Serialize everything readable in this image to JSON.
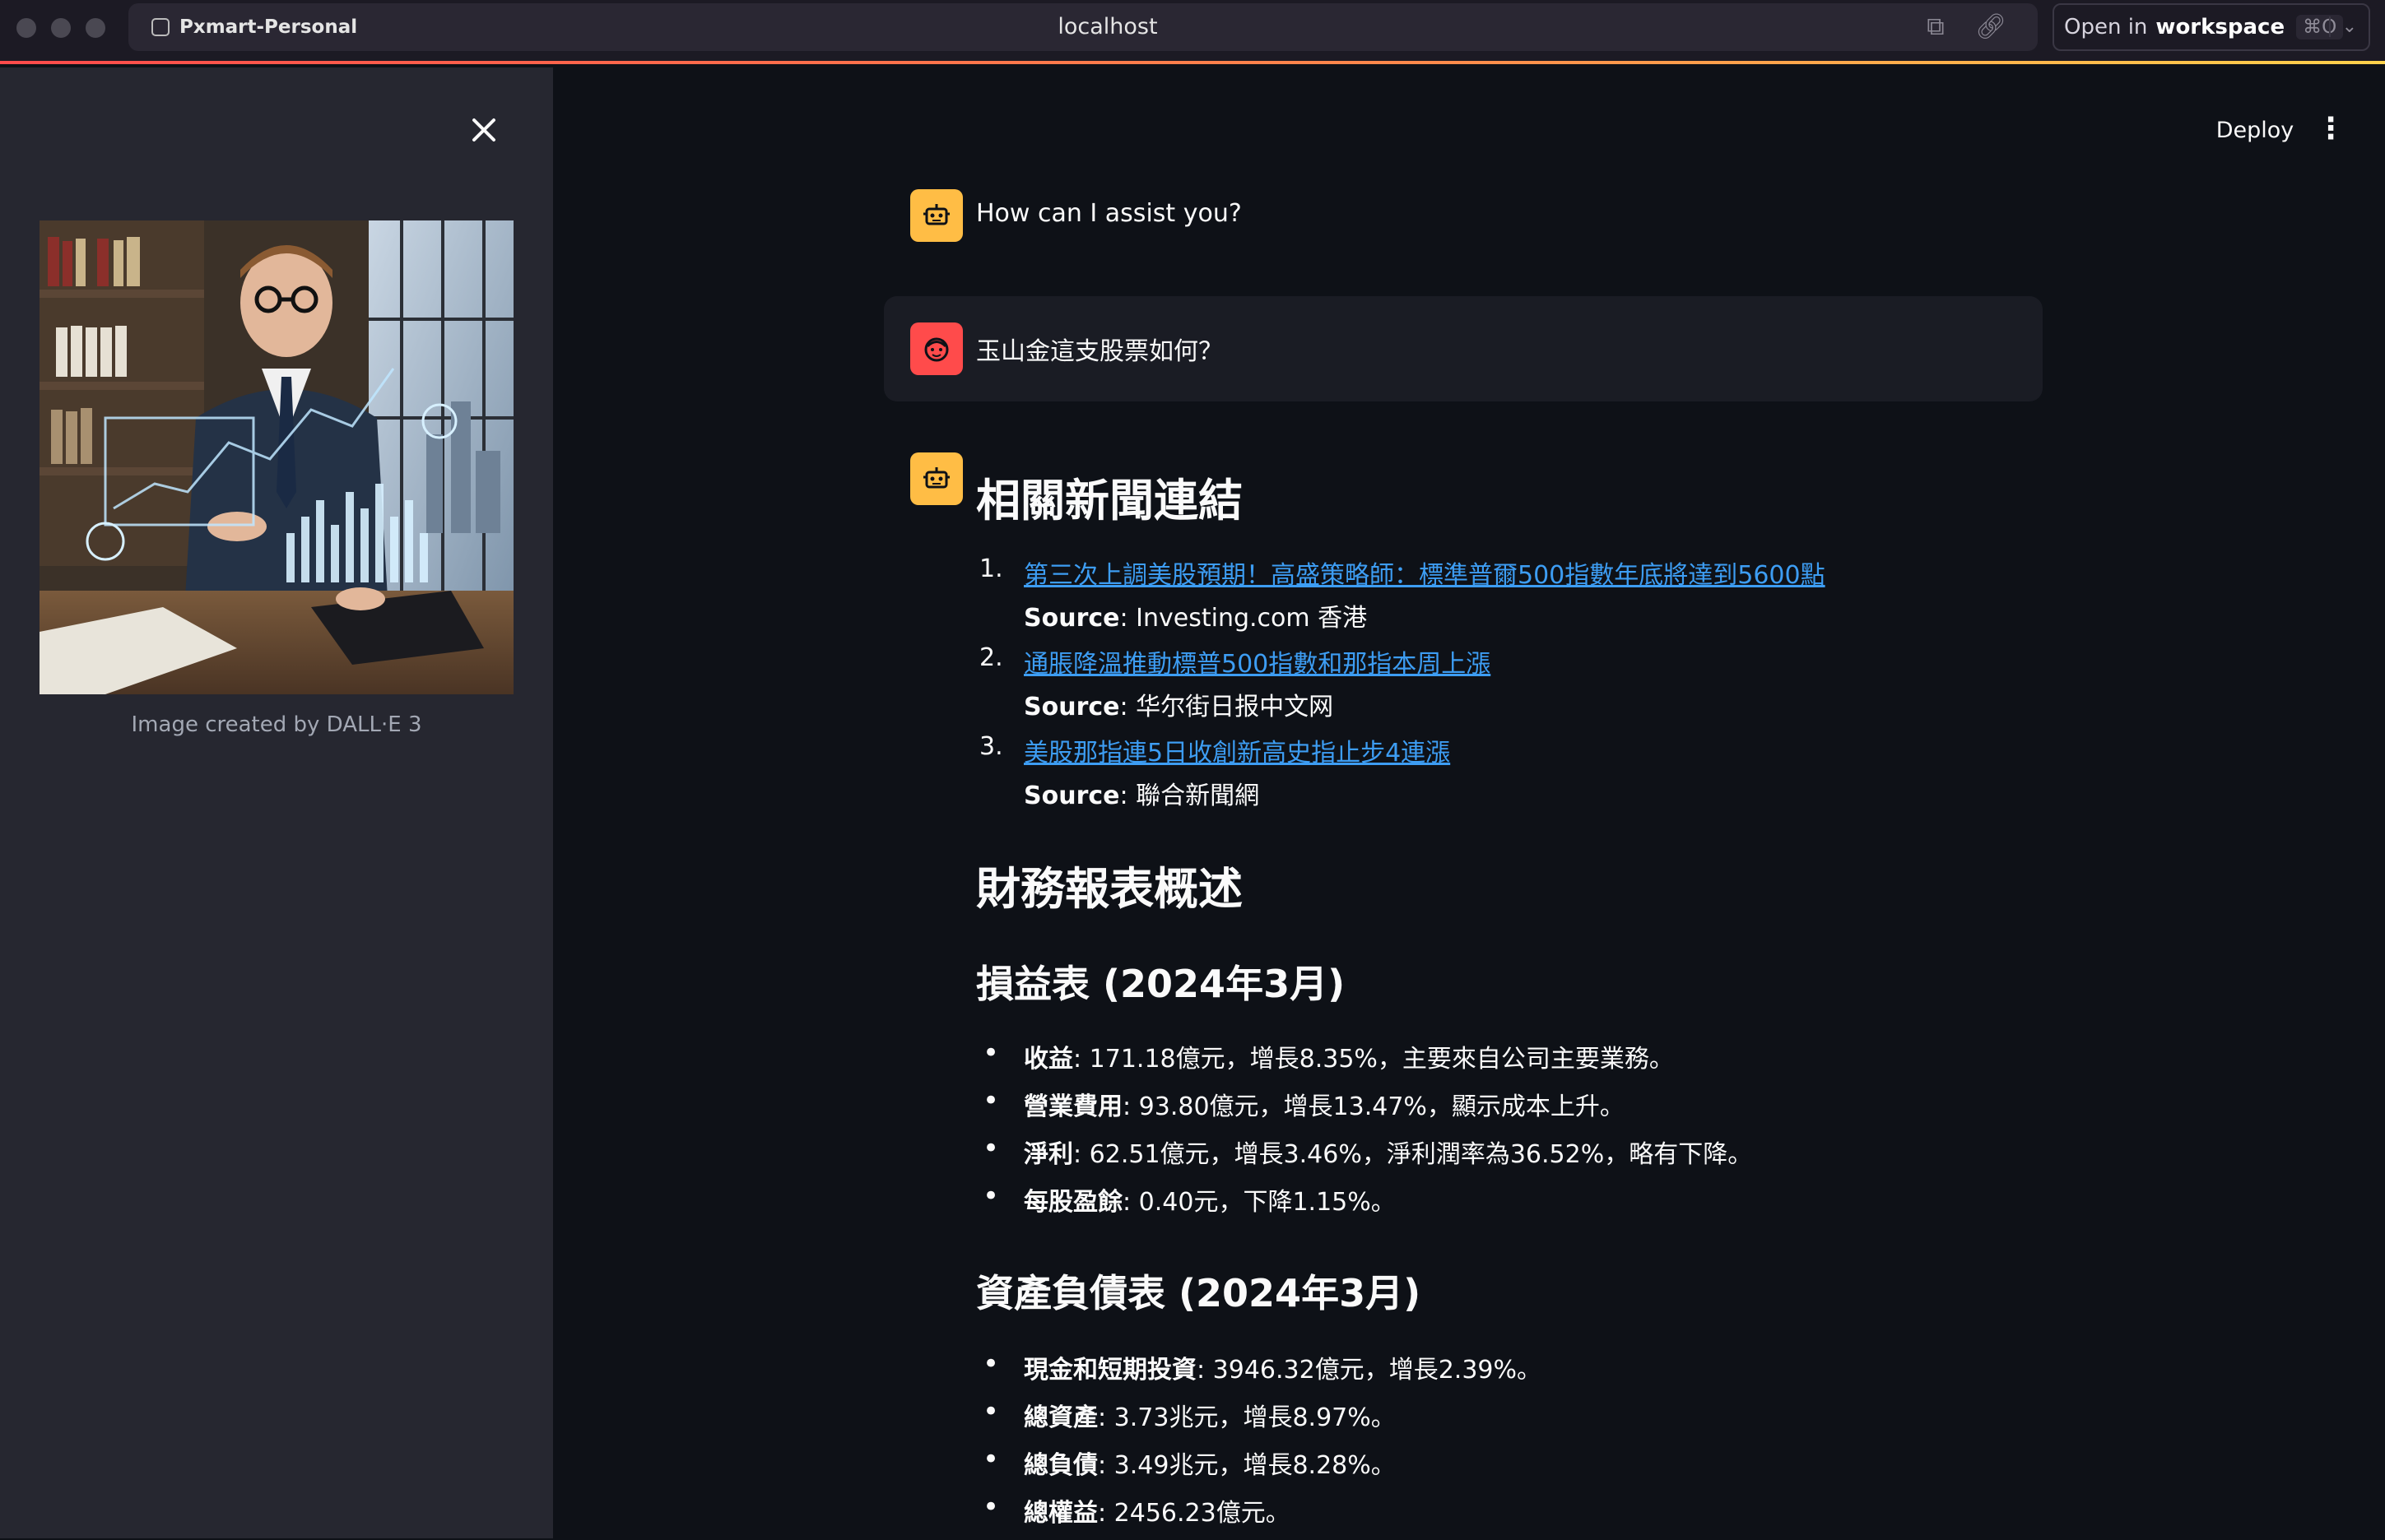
{
  "browser": {
    "tab_title": "Pxmart-Personal",
    "url": "localhost",
    "workspace": {
      "prefix": "Open in",
      "label": "workspace",
      "shortcut": "⌘O"
    }
  },
  "sidebar": {
    "image_caption": "Image created by DALL·E 3"
  },
  "header": {
    "deploy_label": "Deploy"
  },
  "chat": {
    "assistant_greeting": "How can I assist you?",
    "user_message": "玉山金這支股票如何？",
    "news": {
      "heading": "相關新聞連結",
      "source_label": "Source",
      "items": [
        {
          "num": "1.",
          "title": "第三次上調美股預期！高盛策略師：標準普爾500指數年底將達到5600點",
          "source": "Investing.com 香港"
        },
        {
          "num": "2.",
          "title": "通脹降溫推動標普500指數和那指本周上漲",
          "source": "华尔街日报中文网"
        },
        {
          "num": "3.",
          "title": "美股那指連5日收創新高史指止步4連漲",
          "source": "聯合新聞網"
        }
      ]
    },
    "financial": {
      "heading": "財務報表概述",
      "income": {
        "heading": "損益表 (2024年3月)",
        "items": [
          {
            "label": "收益",
            "text": ": 171.18億元，增長8.35%，主要來自公司主要業務。"
          },
          {
            "label": "營業費用",
            "text": ": 93.80億元，增長13.47%，顯示成本上升。"
          },
          {
            "label": "淨利",
            "text": ": 62.51億元，增長3.46%，淨利潤率為36.52%，略有下降。"
          },
          {
            "label": "每股盈餘",
            "text": ": 0.40元，下降1.15%。"
          }
        ]
      },
      "balance": {
        "heading": "資產負債表 (2024年3月)",
        "items": [
          {
            "label": "現金和短期投資",
            "text": ": 3946.32億元，增長2.39%。"
          },
          {
            "label": "總資產",
            "text": ": 3.73兆元，增長8.97%。"
          },
          {
            "label": "總負債",
            "text": ": 3.49兆元，增長8.28%。"
          },
          {
            "label": "總權益",
            "text": ": 2456.23億元。"
          }
        ]
      }
    }
  }
}
